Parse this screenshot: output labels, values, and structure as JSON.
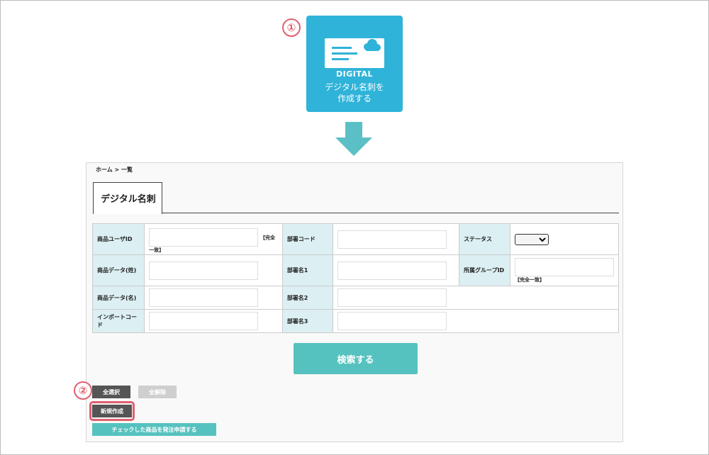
{
  "steps": [
    "①",
    "②"
  ],
  "digital_card": {
    "title": "DIGITAL",
    "line1": "デジタル名刺を",
    "line2": "作成する",
    "icon": "business-card-cloud-icon",
    "color": "#2fb3d9"
  },
  "arrow": {
    "icon": "down-arrow-icon",
    "color": "#5bbfc6"
  },
  "breadcrumb": "ホーム > 一覧",
  "tab_label": "デジタル名刺",
  "filters": {
    "product_user_id": {
      "label": "商品ユーザID",
      "note": "【完全一致】",
      "value": ""
    },
    "dept_code": {
      "label": "部署コード",
      "value": ""
    },
    "status": {
      "label": "ステータス",
      "selected": ""
    },
    "last_name": {
      "label": "商品データ(姓)",
      "value": ""
    },
    "dept_name1": {
      "label": "部署名1",
      "value": ""
    },
    "group_id": {
      "label": "所属グループID",
      "note": "【完全一致】",
      "value": ""
    },
    "first_name": {
      "label": "商品データ(名)",
      "value": ""
    },
    "dept_name2": {
      "label": "部署名2",
      "value": ""
    },
    "import_code": {
      "label": "インポートコード",
      "value": ""
    },
    "dept_name3": {
      "label": "部署名3",
      "value": ""
    }
  },
  "buttons": {
    "search": "検索する",
    "select_all": "全選択",
    "deselect_all": "全解除",
    "create_new": "新規作成",
    "order_request": "チェックした商品を発注申請する"
  },
  "colors": {
    "accent_teal": "#56c2bf",
    "highlight_red": "#e06070"
  }
}
